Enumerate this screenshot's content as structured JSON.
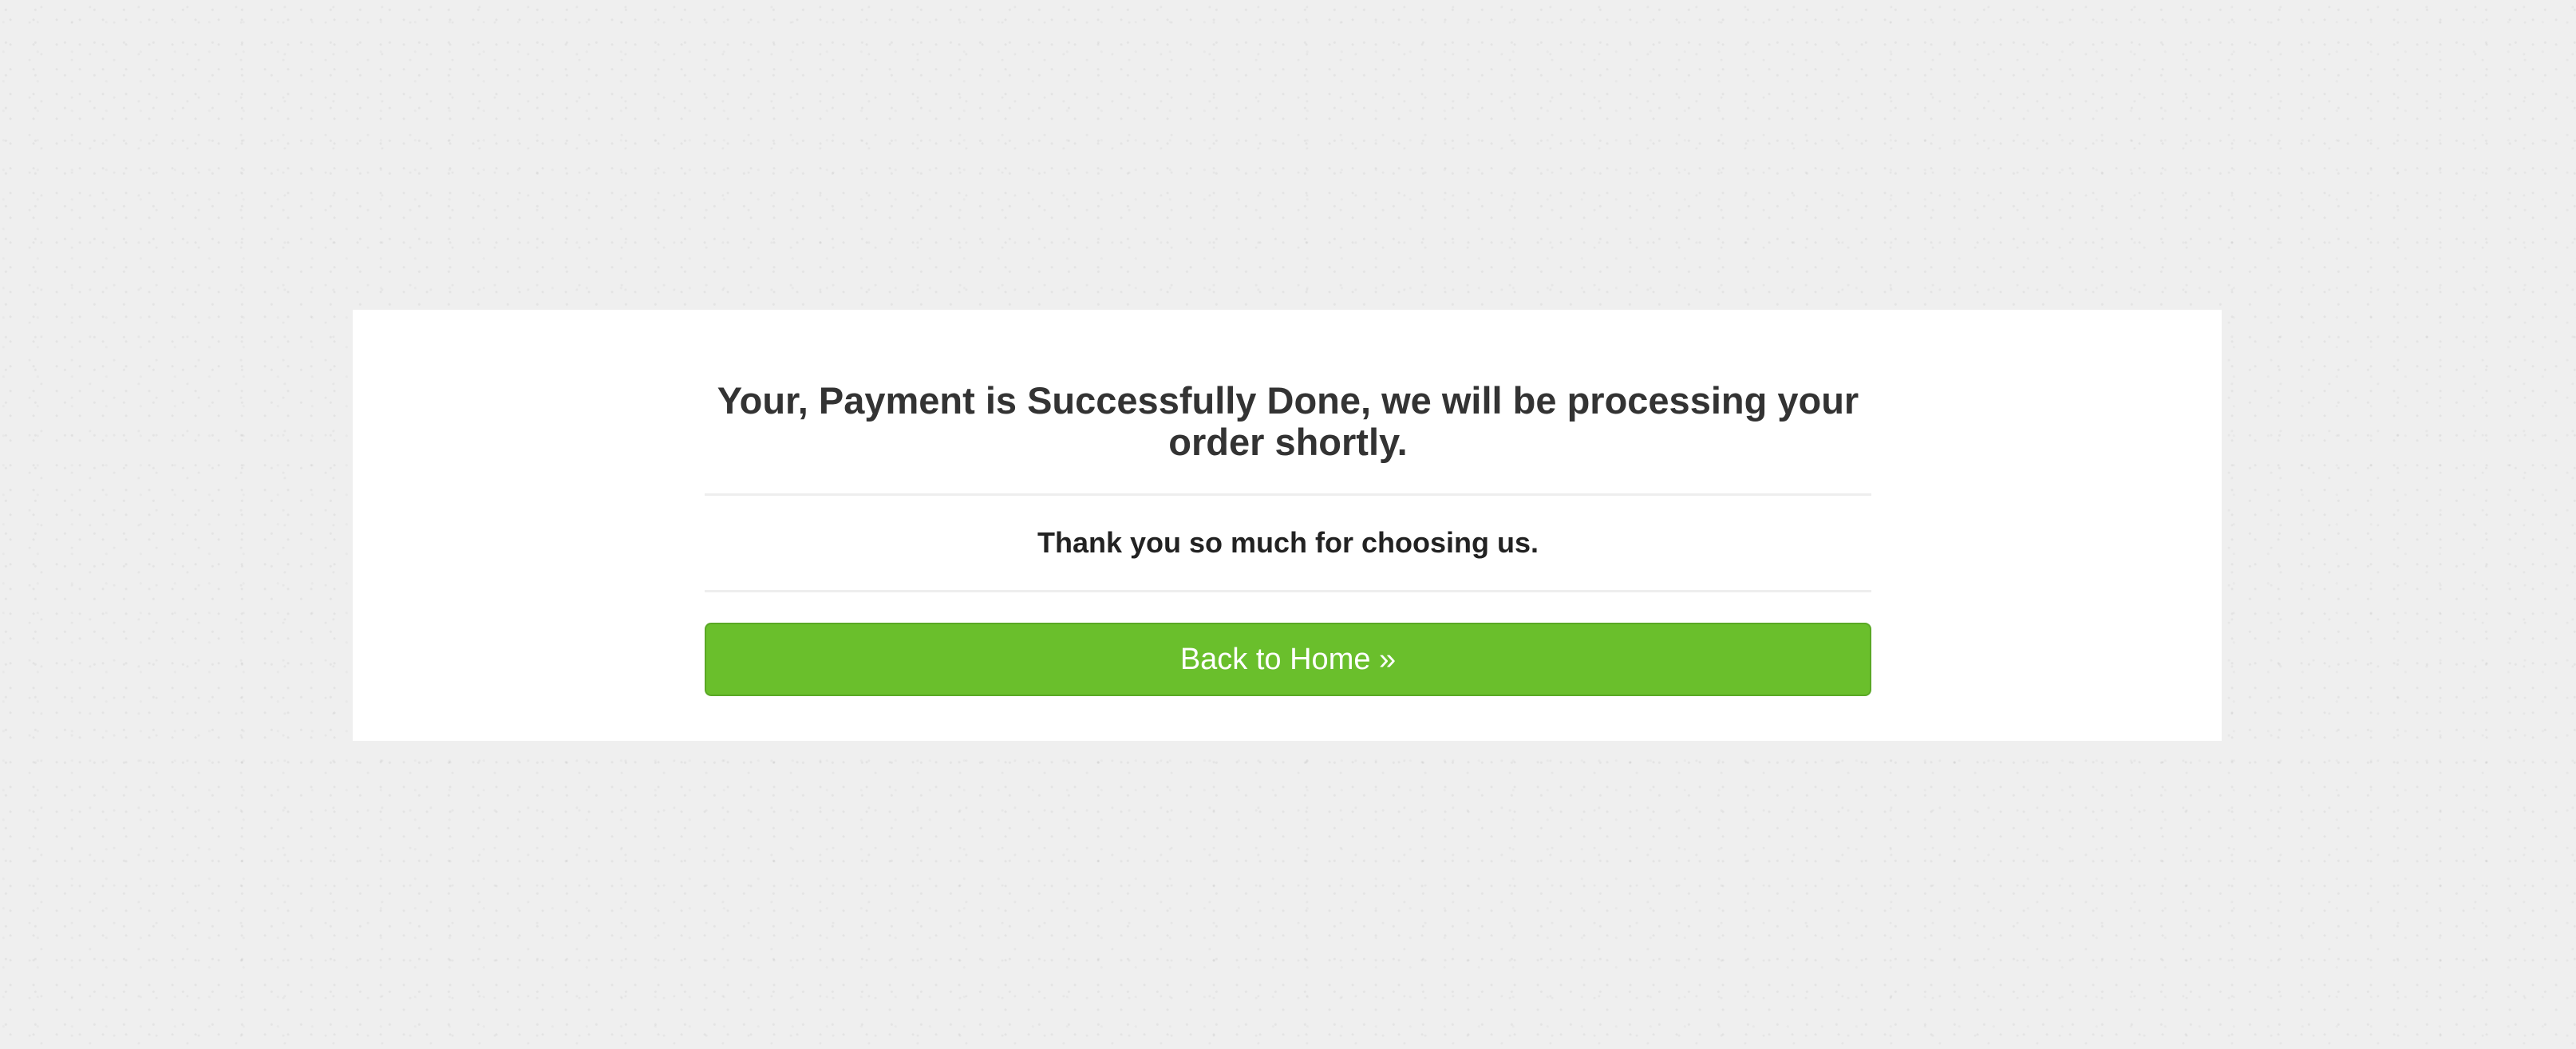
{
  "confirmation": {
    "headline": "Your, Payment is Successfully Done, we will be processing your order shortly.",
    "thanks_message": "Thank you so much for choosing us.",
    "back_button_label": "Back to Home »"
  },
  "colors": {
    "button": "#6abf2c",
    "panel": "#ffffff",
    "background": "#efefef",
    "text": "#333333"
  }
}
